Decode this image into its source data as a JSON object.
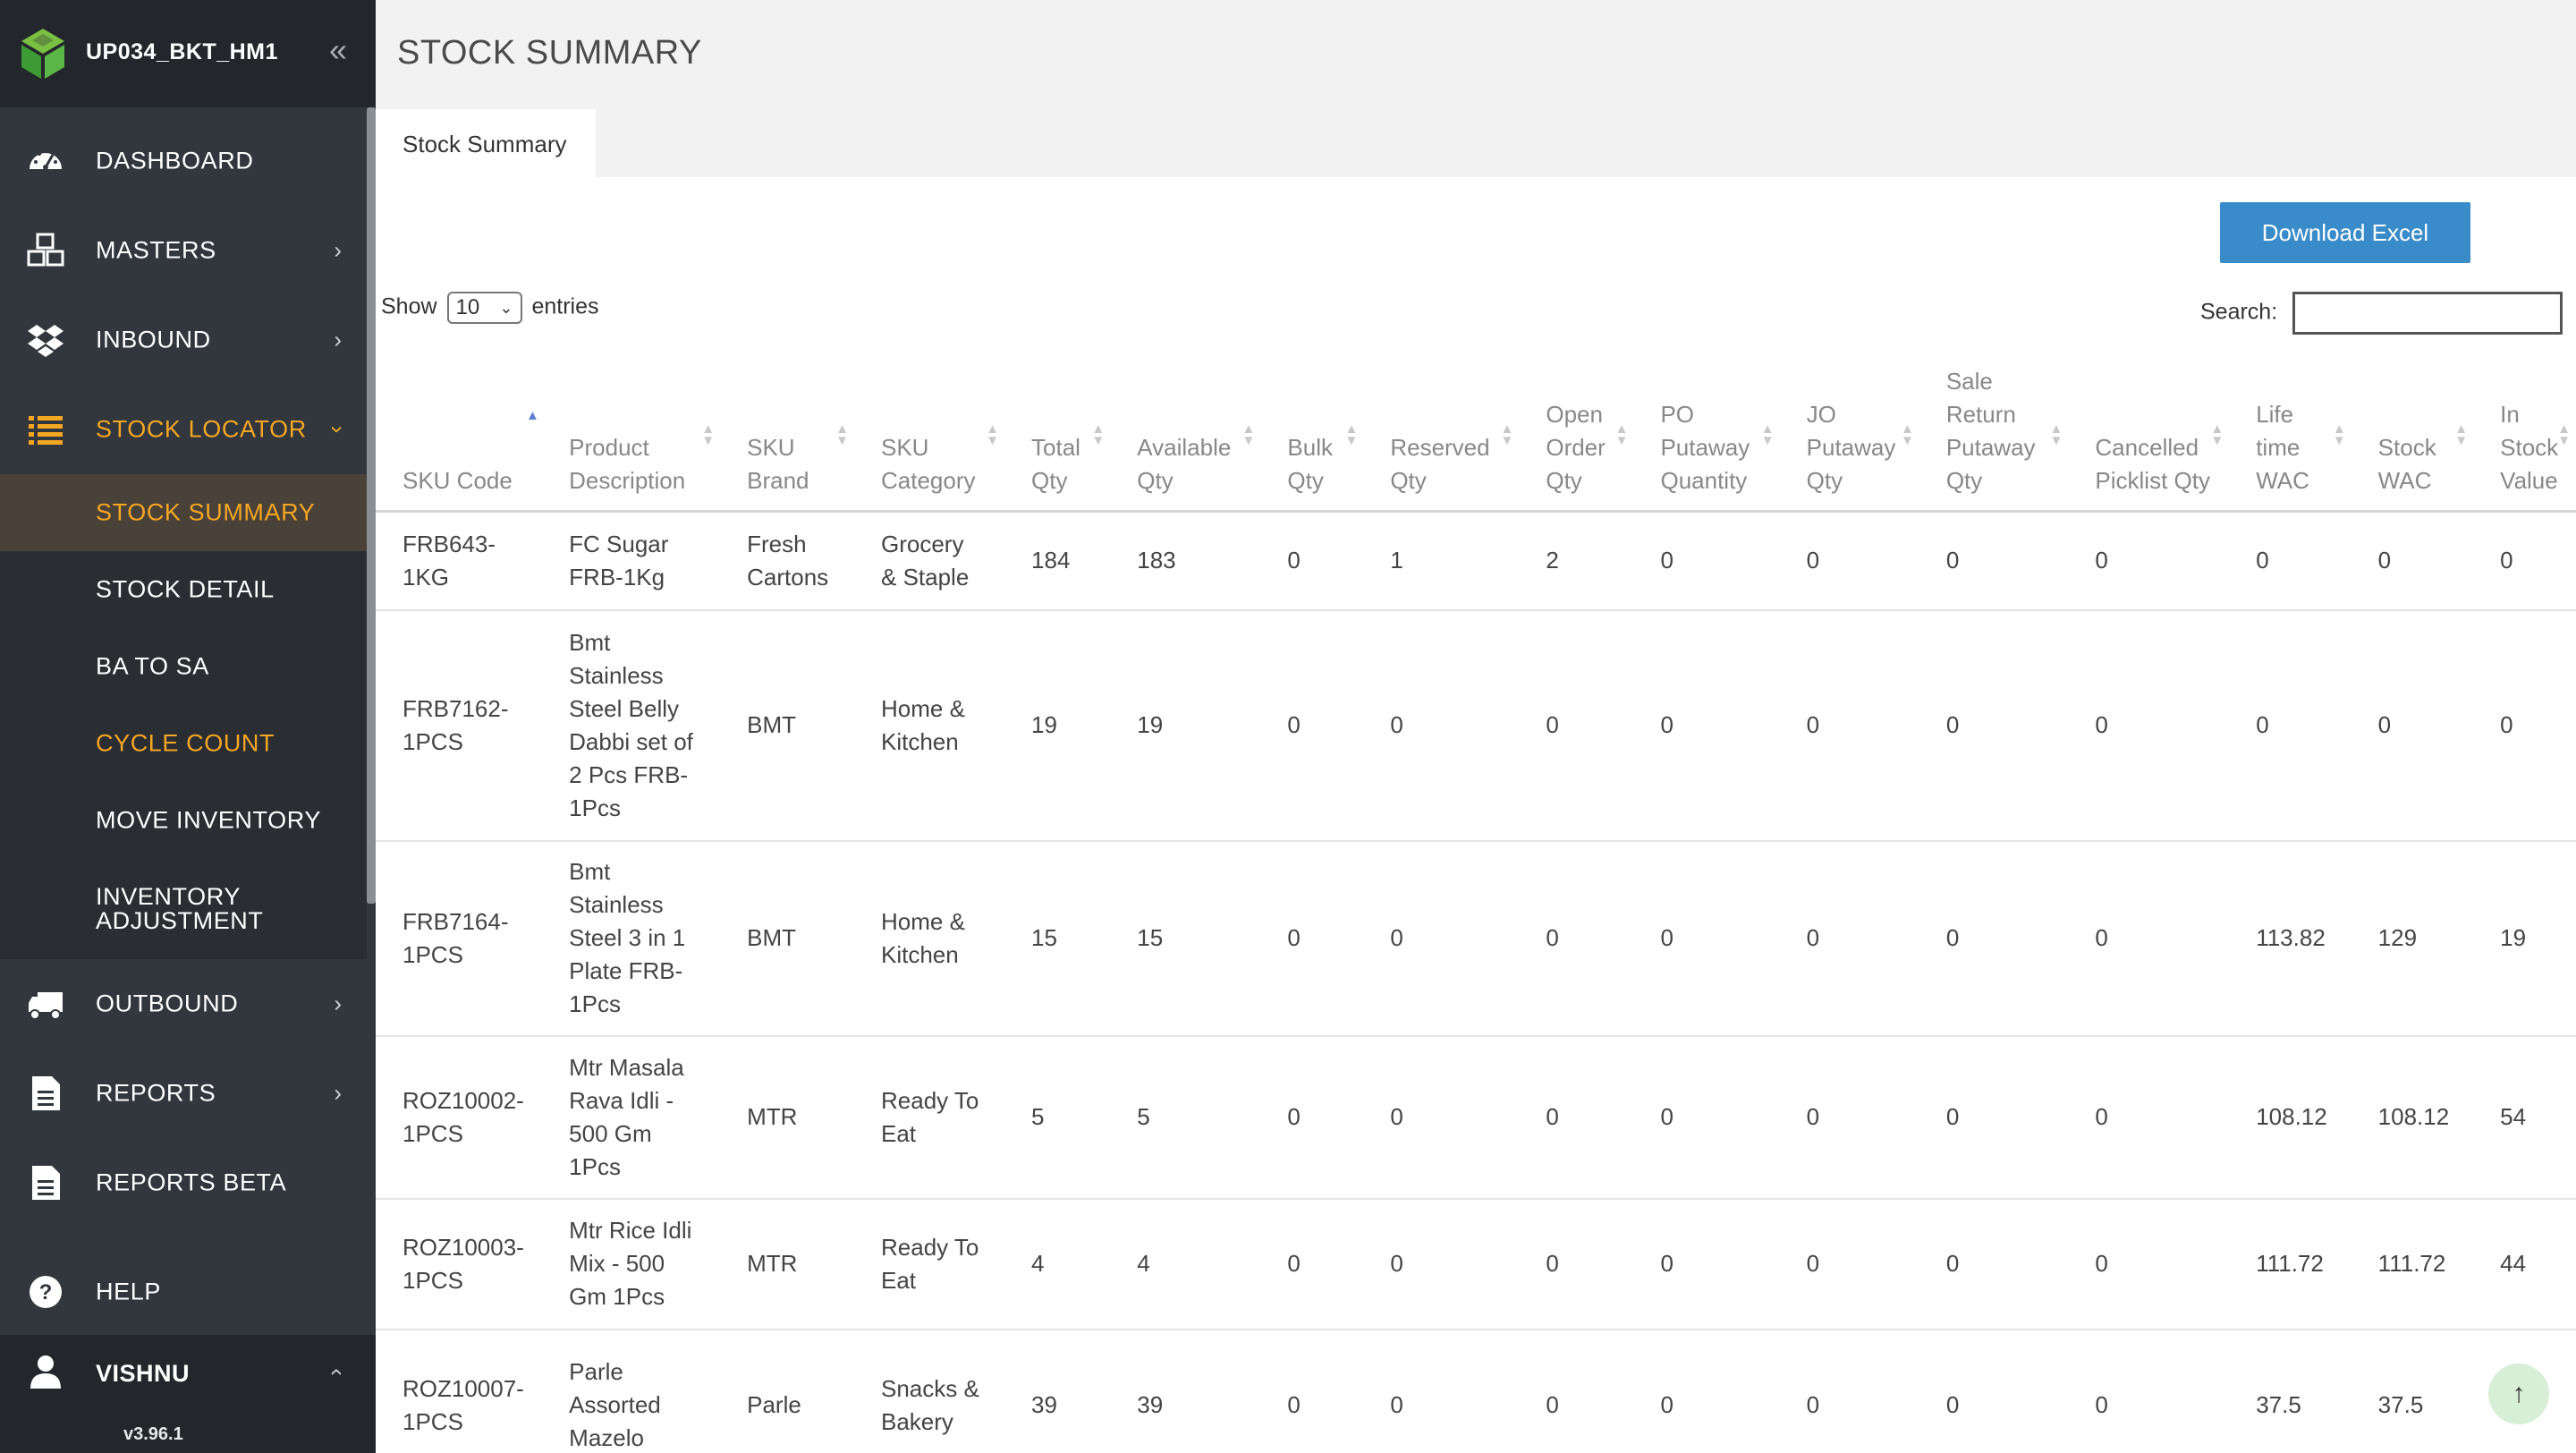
{
  "app": {
    "warehouse_name": "UP034_BKT_HM1",
    "version": "v3.96.1"
  },
  "sidebar": {
    "items": [
      {
        "label": "DASHBOARD",
        "icon": "dashboard-icon"
      },
      {
        "label": "MASTERS",
        "icon": "cubes-icon"
      },
      {
        "label": "INBOUND",
        "icon": "dropbox-icon"
      },
      {
        "label": "STOCK LOCATOR",
        "icon": "list-icon"
      },
      {
        "label": "OUTBOUND",
        "icon": "truck-icon"
      },
      {
        "label": "REPORTS",
        "icon": "document-icon"
      },
      {
        "label": "REPORTS BETA",
        "icon": "document-icon"
      },
      {
        "label": "HELP",
        "icon": "question-circle-icon"
      }
    ],
    "stock_locator_sub": [
      {
        "label": "STOCK SUMMARY"
      },
      {
        "label": "STOCK DETAIL"
      },
      {
        "label": "BA TO SA"
      },
      {
        "label": "CYCLE COUNT"
      },
      {
        "label": "MOVE INVENTORY"
      },
      {
        "label": "INVENTORY ADJUSTMENT"
      }
    ],
    "user": {
      "name": "VISHNU"
    }
  },
  "page": {
    "title": "STOCK SUMMARY",
    "tab_label": "Stock Summary",
    "download_label": "Download Excel",
    "show_label": "Show",
    "entries_value": "10",
    "entries_label": "entries",
    "search_label": "Search:",
    "search_value": ""
  },
  "table": {
    "columns": [
      "SKU Code",
      "Product Description",
      "SKU Brand",
      "SKU Category",
      "Total Qty",
      "Available Qty",
      "Bulk Qty",
      "Reserved Qty",
      "Open Order Qty",
      "PO Putaway Quantity",
      "JO Putaway Qty",
      "Sale Return Putaway Qty",
      "Cancelled Picklist Qty",
      "Life time WAC",
      "Stock WAC",
      "In Stock Value"
    ],
    "rows": [
      [
        "FRB643-1KG",
        "FC Sugar FRB-1Kg",
        "Fresh Cartons",
        "Grocery & Staple",
        "184",
        "183",
        "0",
        "1",
        "2",
        "0",
        "0",
        "0",
        "0",
        "0",
        "0",
        "0"
      ],
      [
        "FRB7162-1PCS",
        "Bmt Stainless Steel Belly Dabbi set of 2 Pcs FRB-1Pcs",
        "BMT",
        "Home & Kitchen",
        "19",
        "19",
        "0",
        "0",
        "0",
        "0",
        "0",
        "0",
        "0",
        "0",
        "0",
        "0"
      ],
      [
        "FRB7164-1PCS",
        "Bmt Stainless Steel 3 in 1 Plate FRB-1Pcs",
        "BMT",
        "Home & Kitchen",
        "15",
        "15",
        "0",
        "0",
        "0",
        "0",
        "0",
        "0",
        "0",
        "113.82",
        "129",
        "19"
      ],
      [
        "ROZ10002-1PCS",
        "Mtr Masala Rava Idli - 500 Gm 1Pcs",
        "MTR",
        "Ready To Eat",
        "5",
        "5",
        "0",
        "0",
        "0",
        "0",
        "0",
        "0",
        "0",
        "108.12",
        "108.12",
        "54"
      ],
      [
        "ROZ10003-1PCS",
        "Mtr Rice Idli Mix - 500 Gm 1Pcs",
        "MTR",
        "Ready To Eat",
        "4",
        "4",
        "0",
        "0",
        "0",
        "0",
        "0",
        "0",
        "0",
        "111.72",
        "111.72",
        "44"
      ],
      [
        "ROZ10007-1PCS",
        "Parle Assorted Mazelo",
        "Parle",
        "Snacks & Bakery",
        "39",
        "39",
        "0",
        "0",
        "0",
        "0",
        "0",
        "0",
        "0",
        "37.5",
        "37.5",
        "14"
      ]
    ]
  }
}
